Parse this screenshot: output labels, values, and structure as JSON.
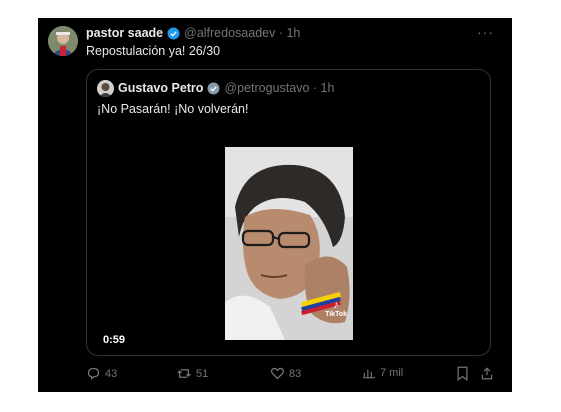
{
  "tweet": {
    "author_name": "pastor saade",
    "author_handle": "@alfredosaadev",
    "time": "1h",
    "text": "Repostulación ya! 26/30",
    "more": "···"
  },
  "quoted": {
    "author_name": "Gustavo Petro",
    "author_handle": "@petrogustavo",
    "time": "1h",
    "text": "¡No Pasarán! ¡No volverán!",
    "video_duration": "0:59",
    "watermark": "TikTok"
  },
  "actions": {
    "replies": "43",
    "reposts": "51",
    "likes": "83",
    "views": "7 mil"
  },
  "colors": {
    "background": "#000000",
    "text": "#e7e9ea",
    "muted": "#71767b",
    "verified": "#1d9bf0",
    "verified_gray": "#829aab"
  }
}
